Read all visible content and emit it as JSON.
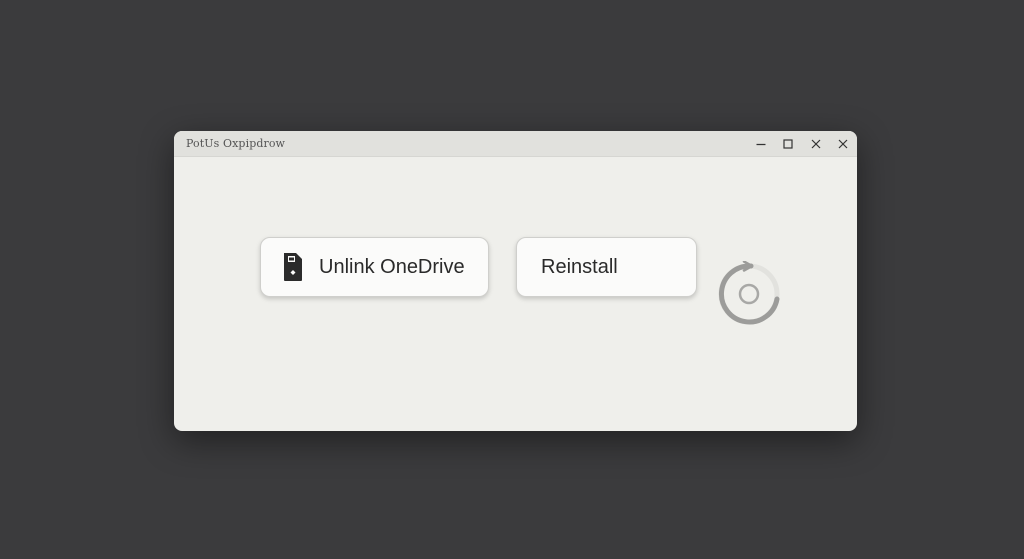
{
  "window": {
    "title": "PotUs Oxpipdrow",
    "controls": [
      "minimize-icon",
      "maximize-icon",
      "close-icon",
      "close-icon"
    ]
  },
  "actions": {
    "unlink_label": "Unlink OneDrive",
    "unlink_icon": "drive-icon",
    "reinstall_label": "Reinstall",
    "refresh_icon": "refresh-icon"
  }
}
